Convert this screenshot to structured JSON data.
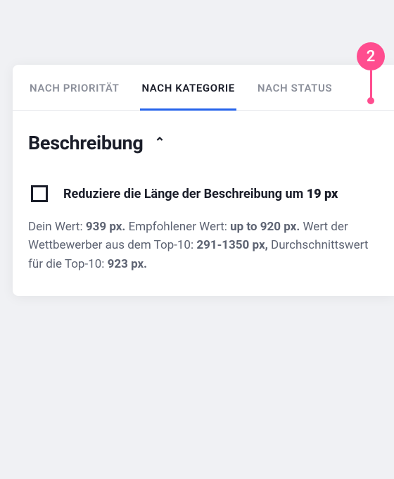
{
  "annotation": {
    "number": "2"
  },
  "tabs": {
    "priority": "NACH PRIORITÄT",
    "category": "NACH KATEGORIE",
    "status": "NACH STATUS"
  },
  "section": {
    "title": "Beschreibung",
    "chevron": "⌃"
  },
  "task": {
    "text_prefix": "Reduziere die Länge der Beschreibung um ",
    "text_value": "19 px"
  },
  "details": {
    "line1_label": "Dein Wert: ",
    "line1_value": "939 px. ",
    "line2_label": "Empfohlener Wert: ",
    "line2_value": "up to 920 px. ",
    "line3_label": "Wert der Wettbewerber aus dem Top-10: ",
    "line3_value": "291-1350 px, ",
    "line4_label": "Durchschnittswert für die Top-10: ",
    "line4_value": "923 px."
  }
}
